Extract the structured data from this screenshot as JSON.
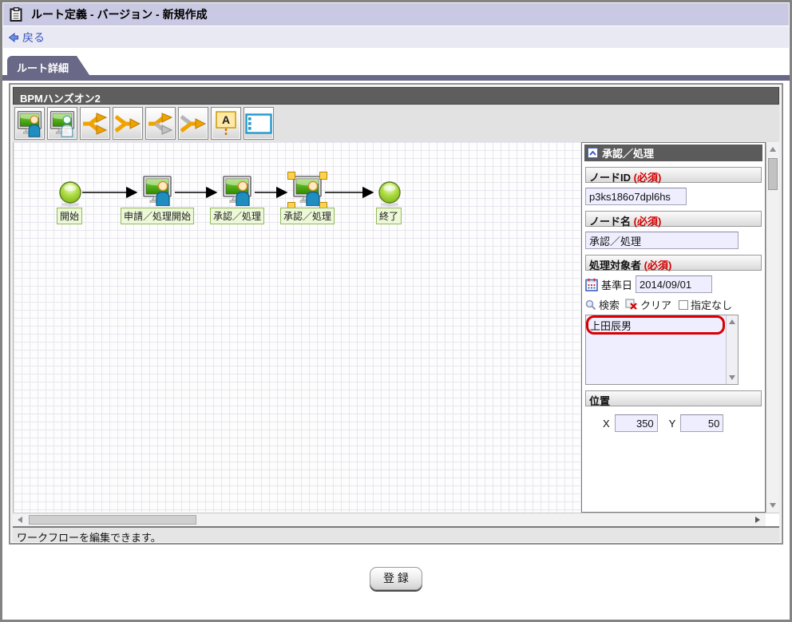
{
  "window": {
    "title": "ルート定義 - バージョン - 新規作成"
  },
  "nav": {
    "back": "戻る"
  },
  "tabs": {
    "route_detail": "ルート詳細"
  },
  "editor": {
    "title": "BPMハンズオン2",
    "annotation_glyph": "A",
    "toolbar_icons": [
      "user-task",
      "dynamic-user-task",
      "branch-split",
      "branch-join",
      "conditional-split",
      "conditional-join",
      "annotation",
      "phase"
    ],
    "status": "ワークフローを編集できます。"
  },
  "workflow": {
    "nodes": [
      {
        "type": "start",
        "label": "開始"
      },
      {
        "type": "task",
        "label": "申請／処理開始"
      },
      {
        "type": "task",
        "label": "承認／処理"
      },
      {
        "type": "task",
        "label": "承認／処理",
        "selected": true
      },
      {
        "type": "end",
        "label": "終了"
      }
    ]
  },
  "panel": {
    "title": "承認／処理",
    "node_id": {
      "label": "ノードID",
      "required": "(必須)",
      "value": "p3ks186o7dpl6hs"
    },
    "node_name": {
      "label": "ノード名",
      "required": "(必須)",
      "value": "承認／処理"
    },
    "target": {
      "label": "処理対象者",
      "required": "(必須)",
      "base_date_label": "基準日",
      "base_date_value": "2014/09/01",
      "search_label": "検索",
      "clear_label": "クリア",
      "none_label": "指定なし",
      "selected_users": [
        "上田辰男"
      ],
      "highlight_color": "#d80000"
    },
    "position": {
      "label": "位置",
      "x_label": "X",
      "x_value": "350",
      "y_label": "Y",
      "y_value": "50"
    }
  },
  "footer": {
    "submit": "登 録"
  },
  "colors": {
    "tab": "#696987",
    "titlebar": "#c9c9e4",
    "required": "#d40000",
    "input_bg": "#eeeeff"
  }
}
